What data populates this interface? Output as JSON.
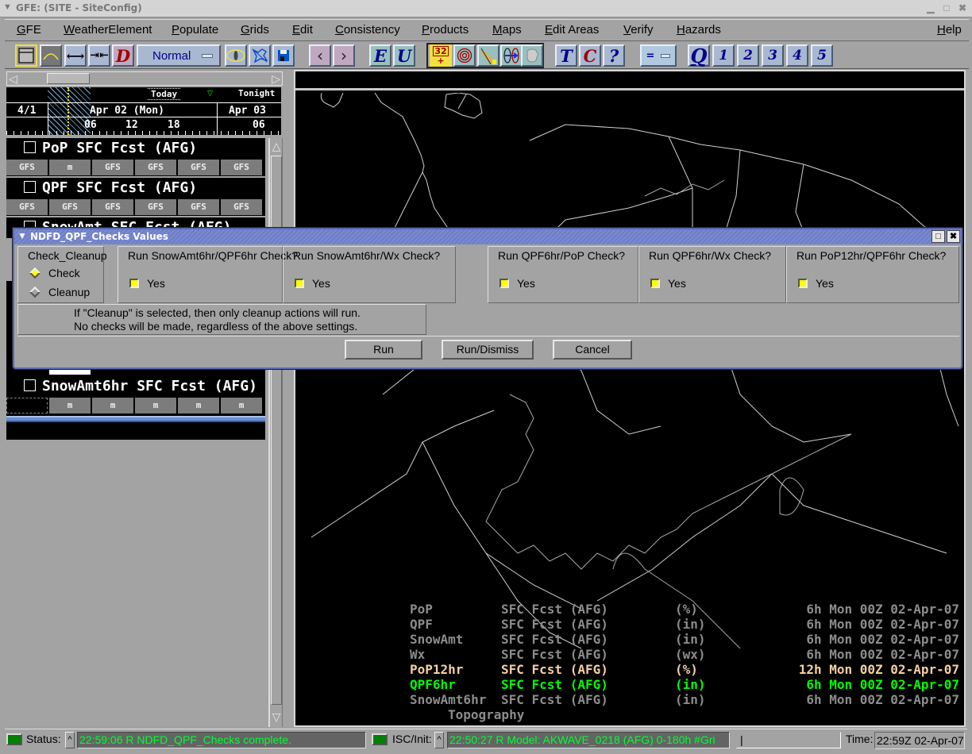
{
  "window": {
    "title": "GFE: (SITE - SiteConfig)"
  },
  "menubar": {
    "items": [
      "GFE",
      "WeatherElement",
      "Populate",
      "Grids",
      "Edit",
      "Consistency",
      "Products",
      "Maps",
      "Edit Areas",
      "Verify",
      "Hazards"
    ],
    "help": "Help"
  },
  "toolbar": {
    "edit_mode": "Normal",
    "letters": {
      "d": "D",
      "e": "E",
      "u": "U",
      "t": "T",
      "c": "C",
      "q": "Q",
      "help": "?"
    },
    "numbered": [
      "1",
      "2",
      "3",
      "4",
      "5"
    ],
    "sample_value": "32",
    "equal_label": "="
  },
  "timescale": {
    "date_prev": "4/1",
    "date_main": "Apr 02 (Mon)",
    "date_next": "Apr 03",
    "hours": [
      "06",
      "12",
      "18",
      "06"
    ],
    "today_label": "Today",
    "tonight_label": "Tonight"
  },
  "grid_manager": {
    "rows": [
      {
        "label": "PoP  SFC  Fcst (AFG)",
        "cells": [
          "GFS",
          "m",
          "GFS",
          "GFS",
          "GFS",
          "GFS"
        ]
      },
      {
        "label": "QPF  SFC  Fcst (AFG)",
        "cells": [
          "GFS",
          "GFS",
          "GFS",
          "GFS",
          "GFS",
          "GFS"
        ]
      },
      {
        "label": "SnowAmt  SFC  Fcst (AFG)",
        "cells": []
      },
      {
        "label": "SnowAmt6hr SFC  Fcst (AFG)",
        "cells": [
          "",
          "m",
          "m",
          "m",
          "m",
          "m"
        ]
      }
    ]
  },
  "map_legend": {
    "rows": [
      {
        "element": "PoP",
        "level": "SFC Fcst (AFG)",
        "units": "(%)",
        "time": "6h Mon 00Z 02-Apr-07",
        "color": "#8c8c8c"
      },
      {
        "element": "QPF",
        "level": "SFC Fcst (AFG)",
        "units": "(in)",
        "time": "6h Mon 00Z 02-Apr-07",
        "color": "#8c8c8c"
      },
      {
        "element": "SnowAmt",
        "level": "SFC Fcst (AFG)",
        "units": "(in)",
        "time": "6h Mon 00Z 02-Apr-07",
        "color": "#8c8c8c"
      },
      {
        "element": "Wx",
        "level": "SFC Fcst (AFG)",
        "units": "(wx)",
        "time": "6h Mon 00Z 02-Apr-07",
        "color": "#8c8c8c"
      },
      {
        "element": "PoP12hr",
        "level": "SFC Fcst (AFG)",
        "units": "(%)",
        "time": "12h Mon 00Z 02-Apr-07",
        "color": "#f5cfa0"
      },
      {
        "element": "QPF6hr",
        "level": "SFC Fcst (AFG)",
        "units": "(in)",
        "time": "6h Mon 00Z 02-Apr-07",
        "color": "#00ff00"
      },
      {
        "element": "SnowAmt6hr",
        "level": "SFC Fcst (AFG)",
        "units": "(in)",
        "time": "6h Mon 00Z 02-Apr-07",
        "color": "#8c8c8c"
      }
    ],
    "topography": "Topography"
  },
  "dialog": {
    "title": "NDFD_QPF_Checks Values",
    "check_cleanup": {
      "header": "Check_Cleanup",
      "options": [
        "Check",
        "Cleanup"
      ],
      "selected": "Check"
    },
    "checks": [
      {
        "header": "Run SnowAmt6hr/QPF6hr Check?",
        "option": "Yes",
        "checked": true
      },
      {
        "header": "Run SnowAmt6hr/Wx Check?",
        "option": "Yes",
        "checked": true
      },
      {
        "header": "Run QPF6hr/PoP Check?",
        "option": "Yes",
        "checked": true
      },
      {
        "header": "Run QPF6hr/Wx Check?",
        "option": "Yes",
        "checked": true
      },
      {
        "header": "Run PoP12hr/QPF6hr Check?",
        "option": "Yes",
        "checked": true
      }
    ],
    "note_line1": "If \"Cleanup\" is selected, then only cleanup actions will run.",
    "note_line2": "No checks will be made, regardless of the above settings.",
    "buttons": {
      "run": "Run",
      "run_dismiss": "Run/Dismiss",
      "cancel": "Cancel"
    }
  },
  "statusbar": {
    "status_label": "Status:",
    "status_message": "22:59:06 R NDFD_QPF_Checks complete.",
    "isc_label": "ISC/Init:",
    "isc_message": "22:50:27 R Model: AKWAVE_0218 (AFG) 0-180h #Gri",
    "input_value": "|",
    "time_label": "Time:",
    "time_value": "22:59Z 02-Apr-07"
  }
}
